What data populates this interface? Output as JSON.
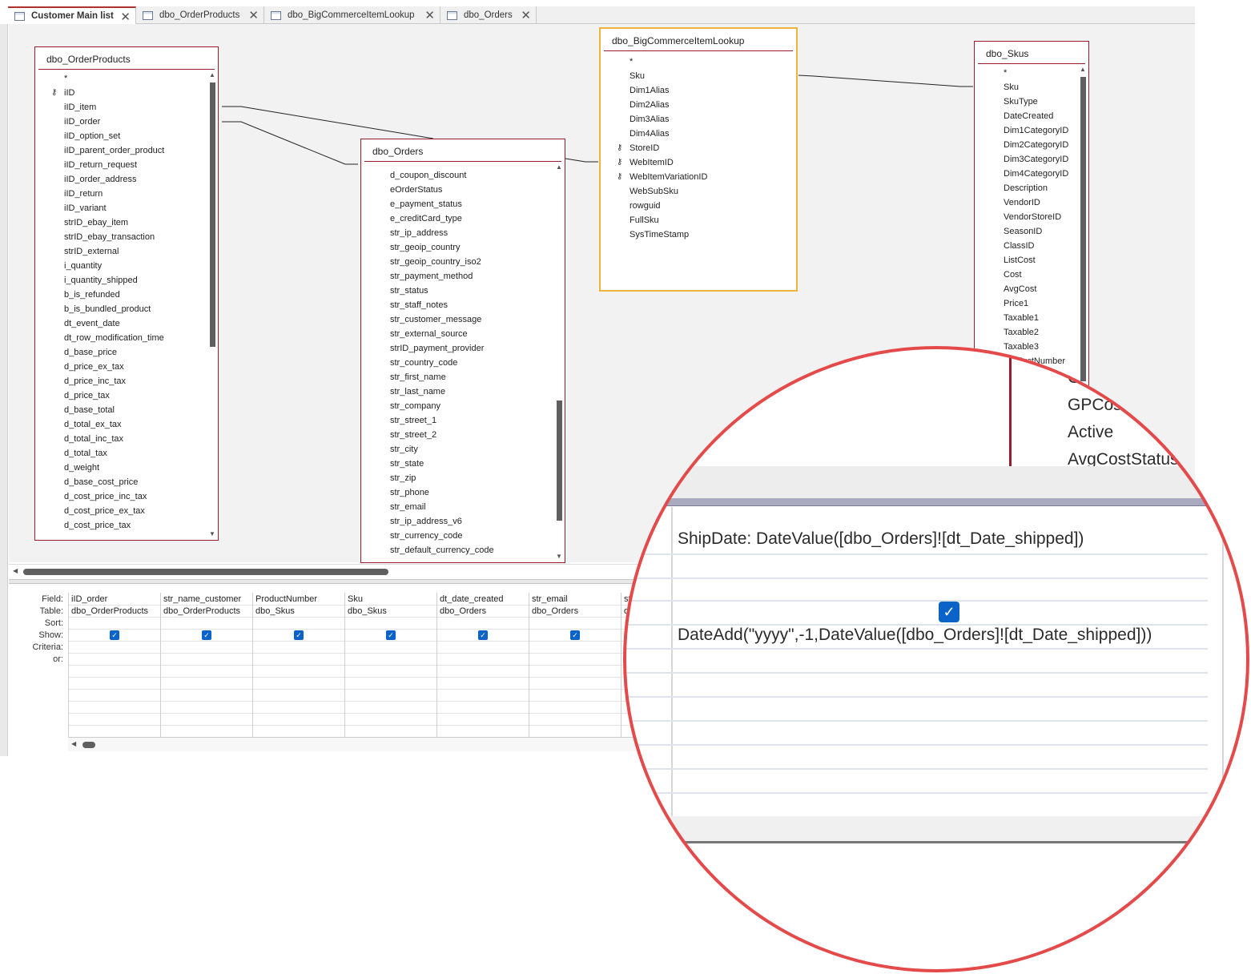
{
  "tabs": [
    {
      "label": "Customer Main list",
      "active": true
    },
    {
      "label": "dbo_OrderProducts"
    },
    {
      "label": "dbo_BigCommerceItemLookup"
    },
    {
      "label": "dbo_Orders"
    }
  ],
  "tables": {
    "order_products": {
      "title": "dbo_OrderProducts",
      "fields": [
        "*",
        "iID",
        "iID_item",
        "iID_order",
        "iID_option_set",
        "iID_parent_order_product",
        "iID_return_request",
        "iID_order_address",
        "iID_return",
        "iID_variant",
        "strID_ebay_item",
        "strID_ebay_transaction",
        "strID_external",
        "i_quantity",
        "i_quantity_shipped",
        "b_is_refunded",
        "b_is_bundled_product",
        "dt_event_date",
        "dt_row_modification_time",
        "d_base_price",
        "d_price_ex_tax",
        "d_price_inc_tax",
        "d_price_tax",
        "d_base_total",
        "d_total_ex_tax",
        "d_total_inc_tax",
        "d_total_tax",
        "d_weight",
        "d_base_cost_price",
        "d_cost_price_inc_tax",
        "d_cost_price_ex_tax",
        "d_cost_price_tax"
      ]
    },
    "orders": {
      "title": "dbo_Orders",
      "fields": [
        "d_coupon_discount",
        "eOrderStatus",
        "e_payment_status",
        "e_creditCard_type",
        "str_ip_address",
        "str_geoip_country",
        "str_geoip_country_iso2",
        "str_payment_method",
        "str_status",
        "str_staff_notes",
        "str_customer_message",
        "str_external_source",
        "strID_payment_provider",
        "str_country_code",
        "str_first_name",
        "str_last_name",
        "str_company",
        "str_street_1",
        "str_street_2",
        "str_city",
        "str_state",
        "str_zip",
        "str_phone",
        "str_email",
        "str_ip_address_v6",
        "str_currency_code",
        "str_default_currency_code"
      ]
    },
    "bigcommerce": {
      "title": "dbo_BigCommerceItemLookup",
      "fields": [
        "*",
        "Sku",
        "Dim1Alias",
        "Dim2Alias",
        "Dim3Alias",
        "Dim4Alias",
        "StoreID",
        "WebItemID",
        "WebItemVariationID",
        "WebSubSku",
        "rowguid",
        "FullSku",
        "SysTimeStamp"
      ]
    },
    "skus": {
      "title": "dbo_Skus",
      "fields": [
        "*",
        "Sku",
        "SkuType",
        "DateCreated",
        "Dim1CategoryID",
        "Dim2CategoryID",
        "Dim3CategoryID",
        "Dim4CategoryID",
        "Description",
        "VendorID",
        "VendorStoreID",
        "SeasonID",
        "ClassID",
        "ListCost",
        "Cost",
        "AvgCost",
        "Price1",
        "Taxable1",
        "Taxable2",
        "Taxable3",
        "ProductNumber"
      ]
    }
  },
  "grid": {
    "row_labels": {
      "field": "Field:",
      "table": "Table:",
      "sort": "Sort:",
      "show": "Show:",
      "criteria": "Criteria:",
      "or": "or:"
    },
    "columns": [
      {
        "field": "iID_order",
        "table": "dbo_OrderProducts",
        "show": true
      },
      {
        "field": "str_name_customer",
        "table": "dbo_OrderProducts",
        "show": true
      },
      {
        "field": "ProductNumber",
        "table": "dbo_Skus",
        "show": true
      },
      {
        "field": "Sku",
        "table": "dbo_Skus",
        "show": true
      },
      {
        "field": "dt_date_created",
        "table": "dbo_Orders",
        "show": true
      },
      {
        "field": "str_email",
        "table": "dbo_Orders",
        "show": true
      },
      {
        "field": "st",
        "table": "d",
        "show": false
      }
    ]
  },
  "zoom": {
    "skus_fields": [
      "G",
      "GPCost",
      "Active",
      "AvgCostStatus"
    ],
    "field_expr": "ShipDate: DateValue([dbo_Orders]![dt_Date_shipped])",
    "criteria_expr": "DateAdd(\"yyyy\",-1,DateValue([dbo_Orders]![dt_Date_shipped]))",
    "show_checked": true
  },
  "colors": {
    "table_border": "#9a1c2a",
    "selected_border": "#f0b43a",
    "checkbox": "#0a63c9",
    "callout": "#e44a4a"
  }
}
